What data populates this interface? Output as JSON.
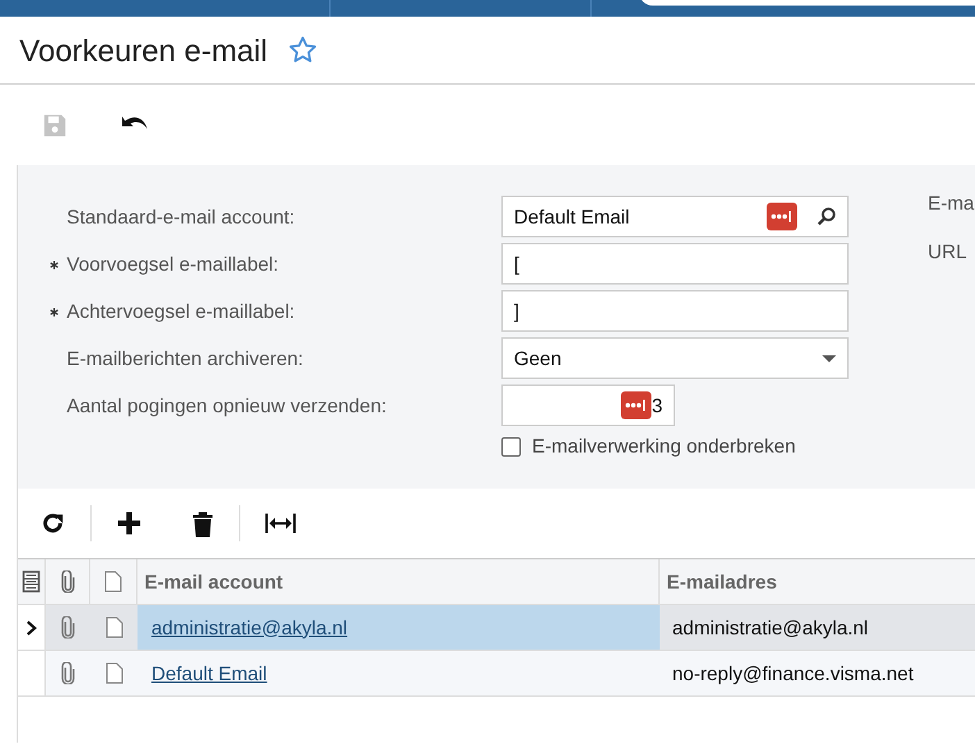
{
  "page": {
    "title": "Voorkeuren e-mail"
  },
  "form": {
    "fields": [
      {
        "kind": "lookup",
        "label": "Standaard-e-mail account:",
        "required": false,
        "value": "Default Email"
      },
      {
        "kind": "text",
        "label": "Voorvoegsel e-maillabel:",
        "required": true,
        "value": "["
      },
      {
        "kind": "text",
        "label": "Achtervoegsel e-maillabel:",
        "required": true,
        "value": "]"
      },
      {
        "kind": "select",
        "label": "E-mailberichten archiveren:",
        "required": false,
        "value": "Geen"
      },
      {
        "kind": "number",
        "label": "Aantal pogingen opnieuw verzenden:",
        "required": false,
        "value": "3"
      }
    ],
    "checkbox": {
      "label": "E-mailverwerking onderbreken",
      "checked": false
    },
    "right_labels": [
      "E-ma",
      "URL"
    ]
  },
  "table": {
    "columns": [
      "E-mail account",
      "E-mailadres"
    ],
    "rows": [
      {
        "selected": true,
        "account": "administratie@akyla.nl",
        "address": "administratie@akyla.nl"
      },
      {
        "selected": false,
        "account": "Default Email",
        "address": "no-reply@finance.visma.net"
      }
    ]
  }
}
